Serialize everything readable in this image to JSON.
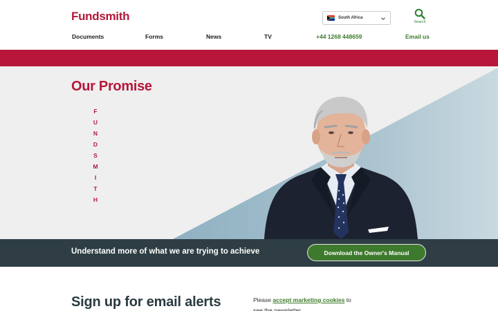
{
  "brand": {
    "name": "Fundsmith",
    "color": "#b5173a"
  },
  "header": {
    "region": {
      "selected": "South Africa",
      "flag_icon": "south-africa-flag-icon"
    },
    "search": {
      "label": "Search",
      "icon": "search-icon"
    },
    "nav": {
      "documents": "Documents",
      "forms": "Forms",
      "news": "News",
      "tv": "TV",
      "phone": "+44 1268 448659",
      "email": "Email us"
    }
  },
  "hero": {
    "title": "Our Promise",
    "letters": [
      "F",
      "U",
      "N",
      "D",
      "S",
      "M",
      "I",
      "T",
      "H"
    ]
  },
  "banner": {
    "text": "Understand more of what we are trying to achieve",
    "button_label": "Download the Owner's Manual"
  },
  "signup": {
    "heading": "Sign up for email alerts",
    "notice_prefix": "Please",
    "notice_link": "accept marketing cookies",
    "notice_suffix": "to see the newsletter"
  },
  "colors": {
    "accent_red": "#b8163a",
    "accent_green": "#3d7a2a",
    "banner_bg": "#2e3e44",
    "hero_bg": "#efefef"
  }
}
